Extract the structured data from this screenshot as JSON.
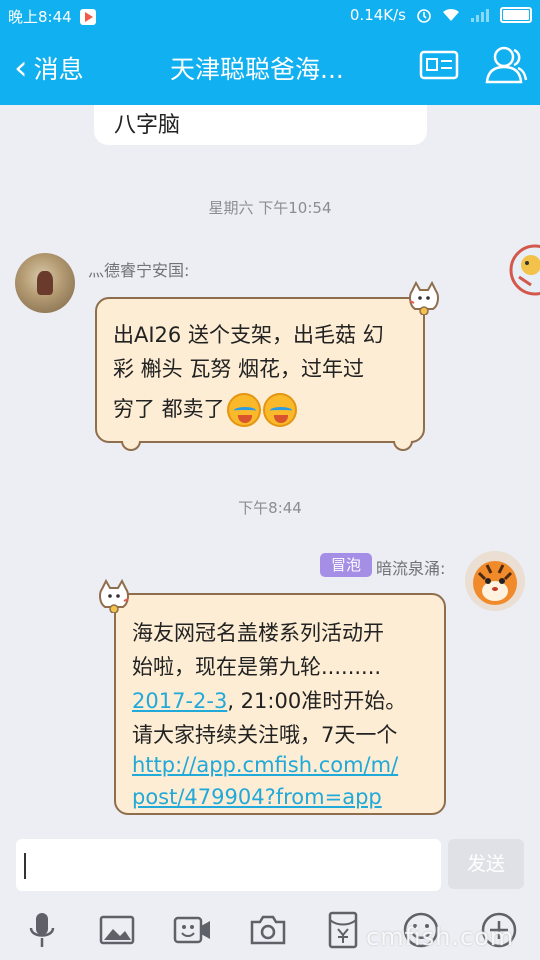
{
  "status_bar": {
    "time": "晚上8:44",
    "network_speed": "0.14K/s"
  },
  "header": {
    "back_label": "消息",
    "title": "天津聪聪爸海..."
  },
  "previous_message": {
    "text": "八字脑"
  },
  "messages": [
    {
      "timestamp": "星期六 下午10:54",
      "sender": "灬德睿宁安国:",
      "lines": [
        "出AI26 送个支架，出毛菇 幻",
        "彩 槲头 瓦努 烟花，过年过",
        "穷了 都卖了"
      ],
      "emoji": [
        "crying-laughing-emoji",
        "crying-laughing-emoji"
      ]
    },
    {
      "timestamp": "下午8:44",
      "badge": "冒泡",
      "sender": "暗流泉涌:",
      "line1": "海友网冠名盖楼系列活动开",
      "line2": "始啦，现在是第九轮.........",
      "line3_link": "2017-2-3",
      "line3_rest": ", 21:00准时开始。",
      "line4": "请大家持续关注哦，7天一个",
      "link_line1": "http://app.cmfish.com/m/",
      "link_line2": "post/479904?from=app"
    }
  ],
  "input": {
    "send_label": "发送"
  },
  "watermark": "cmfish.com",
  "colors": {
    "header_bg": "#11b0f0",
    "bubble_bg": "#fcedd4",
    "bubble_border": "#8f6e4d",
    "link": "#21a9d9",
    "badge_bg": "#a48ee6"
  }
}
